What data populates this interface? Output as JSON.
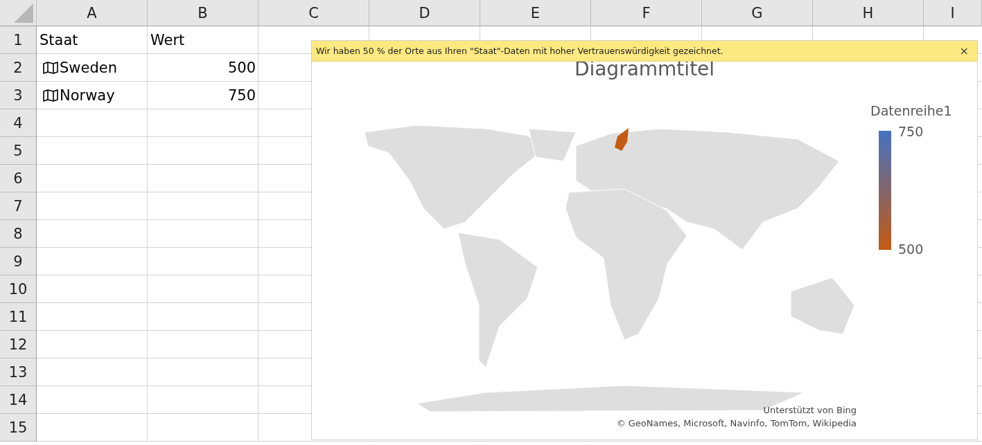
{
  "sheet": {
    "columns": [
      "A",
      "B",
      "C",
      "D",
      "E",
      "F",
      "G",
      "H",
      "I"
    ],
    "rows": [
      {
        "number": "1",
        "cells": [
          {
            "kind": "text",
            "text": "Staat"
          },
          {
            "kind": "text",
            "text": "Wert"
          }
        ]
      },
      {
        "number": "2",
        "cells": [
          {
            "kind": "geography",
            "text": "Sweden"
          },
          {
            "kind": "number",
            "text": "500"
          }
        ]
      },
      {
        "number": "3",
        "cells": [
          {
            "kind": "geography",
            "text": "Norway"
          },
          {
            "kind": "number",
            "text": "750"
          }
        ]
      },
      {
        "number": "4",
        "cells": []
      },
      {
        "number": "5",
        "cells": []
      },
      {
        "number": "6",
        "cells": []
      },
      {
        "number": "7",
        "cells": []
      },
      {
        "number": "8",
        "cells": []
      },
      {
        "number": "9",
        "cells": []
      },
      {
        "number": "10",
        "cells": []
      },
      {
        "number": "11",
        "cells": []
      },
      {
        "number": "12",
        "cells": []
      },
      {
        "number": "13",
        "cells": []
      },
      {
        "number": "14",
        "cells": []
      },
      {
        "number": "15",
        "cells": []
      }
    ]
  },
  "chart": {
    "banner": {
      "message": "Wir haben 50 % der Orte aus Ihren \"Staat\"-Daten mit hoher Vertrauenswürdigkeit gezeichnet.",
      "close": "×"
    },
    "title": "Diagrammtitel",
    "legend": {
      "title": "Datenreihe1",
      "max": "750",
      "min": "500"
    },
    "attribution": [
      "Unterstützt von Bing",
      "© GeoNames, Microsoft, Navinfo, TomTom, Wikipedia"
    ]
  }
}
